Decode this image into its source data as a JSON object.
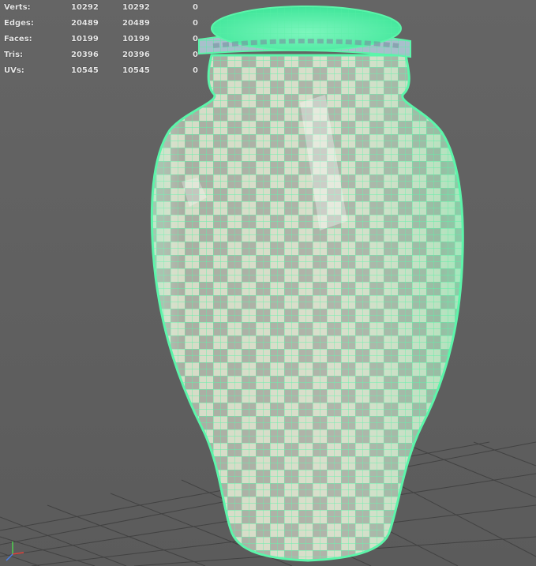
{
  "heads_up_display": {
    "rows": [
      {
        "label": "Verts:",
        "total": "10292",
        "selected": "10292",
        "extra": "0"
      },
      {
        "label": "Edges:",
        "total": "20489",
        "selected": "20489",
        "extra": "0"
      },
      {
        "label": "Faces:",
        "total": "10199",
        "selected": "10199",
        "extra": "0"
      },
      {
        "label": "Tris:",
        "total": "20396",
        "selected": "20396",
        "extra": "0"
      },
      {
        "label": "UVs:",
        "total": "10545",
        "selected": "10545",
        "extra": "0"
      }
    ]
  },
  "viewport": {
    "background_color": "#5e5e5e",
    "grid_color": "#3f3f3f",
    "wireframe_color": "#55f5a8",
    "checker_light": "#d2d8c2",
    "checker_dark": "#a4a89c"
  },
  "axis_gizmo": {
    "x_color": "#e0413a",
    "y_color": "#4fd04f",
    "z_color": "#4a7fe6"
  }
}
